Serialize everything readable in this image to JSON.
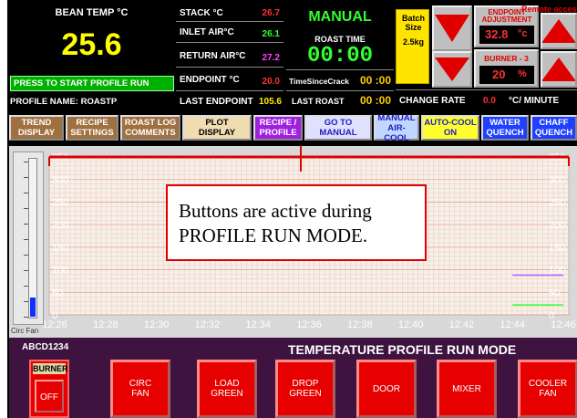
{
  "top": {
    "bean_temp_label": "BEAN TEMP °C",
    "bean_temp_value": "25.6",
    "start_profile_button": "PRESS TO START PROFILE RUN",
    "profile_name": "PROFILE NAME: ROASTP",
    "stack_label": "STACK °C",
    "stack_value": "26.7",
    "inlet_label": "INLET AIR°C",
    "inlet_value": "26.1",
    "return_label": "RETURN AIR°C",
    "return_value": "27.2",
    "endpoint_label": "ENDPOINT °C",
    "endpoint_value": "20.0",
    "last_endpoint_label": "LAST ENDPOINT",
    "last_endpoint_value": "105.6",
    "mode": "MANUAL",
    "roast_time_label": "ROAST TIME",
    "roast_time_value": "00:00",
    "time_since_crack_label": "TimeSinceCrack",
    "time_since_crack_value": "00 :00",
    "last_roast_label": "LAST ROAST",
    "last_roast_value": "00 :00",
    "batch_label": "Batch Size",
    "batch_value": "2.5kg",
    "endpoint_adjust_label": "ENDPOINT ADJUSTMENT",
    "endpoint_adjust_value": "32.8",
    "endpoint_adjust_unit": "°c",
    "remote_access": "Remote access",
    "burner_label": "BURNER - 3",
    "burner_value": "20",
    "burner_unit": "%",
    "change_rate_label": "CHANGE RATE",
    "change_rate_value": "0.0",
    "change_rate_unit": "°C/ MINUTE"
  },
  "nav": [
    {
      "line1": "TREND",
      "line2": "DISPLAY"
    },
    {
      "line1": "RECIPE",
      "line2": "SETTINGS"
    },
    {
      "line1": "ROAST LOG",
      "line2": "COMMENTS"
    },
    {
      "line1": "PLOT",
      "line2": "DISPLAY"
    },
    {
      "line1": "RECIPE /",
      "line2": "PROFILE"
    },
    {
      "line1": "GO TO",
      "line2": "MANUAL"
    },
    {
      "line1": "MANUAL",
      "line2": "AIR-COOL"
    },
    {
      "line1": "AUTO-COOL",
      "line2": "ON"
    },
    {
      "line1": "WATER",
      "line2": "QUENCH"
    },
    {
      "line1": "CHAFF",
      "line2": "QUENCH"
    }
  ],
  "callout": {
    "line1": "Buttons are active during",
    "line2": "PROFILE RUN MODE."
  },
  "gauge": {
    "label": "Circ Fan",
    "level_fraction": 0.12
  },
  "chart_data": {
    "type": "line",
    "x_ticks": [
      "12:26",
      "12:28",
      "12:30",
      "12:32",
      "12:34",
      "12:36",
      "12:38",
      "12:40",
      "12:42",
      "12:44",
      "12:46"
    ],
    "y_ticks": [
      "0",
      "50",
      "100",
      "150",
      "200",
      "250",
      "300",
      "350"
    ],
    "ylim": [
      0,
      350
    ],
    "grid": true,
    "series": [
      {
        "color": "#b060ff",
        "values_tail": [
          {
            "x": "12:44",
            "y": 88
          },
          {
            "x": "12:46",
            "y": 88
          }
        ]
      },
      {
        "color": "#30ff30",
        "values_tail": [
          {
            "x": "12:44",
            "y": 22
          },
          {
            "x": "12:46",
            "y": 22
          }
        ]
      }
    ]
  },
  "bottom": {
    "id": "ABCD1234",
    "mode_title": "TEMPERATURE PROFILE RUN MODE",
    "burner_label": "BURNER",
    "burner_state": "OFF",
    "buttons": [
      {
        "line1": "CIRC",
        "line2": "FAN"
      },
      {
        "line1": "LOAD",
        "line2": "GREEN"
      },
      {
        "line1": "DROP",
        "line2": "GREEN"
      },
      {
        "line1": "DOOR",
        "line2": ""
      },
      {
        "line1": "MIXER",
        "line2": ""
      },
      {
        "line1": "COOLER",
        "line2": "FAN"
      }
    ]
  }
}
